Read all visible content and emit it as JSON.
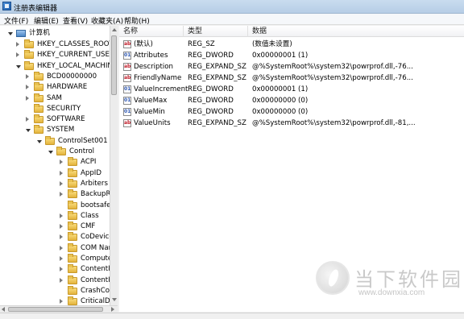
{
  "window": {
    "title": "注册表编辑器"
  },
  "menu": [
    "文件(F)",
    "编辑(E)",
    "查看(V)",
    "收藏夹(A)",
    "帮助(H)"
  ],
  "tree": {
    "root": "计算机",
    "items": [
      {
        "label": "HKEY_CLASSES_ROOT",
        "state": "collapsed"
      },
      {
        "label": "HKEY_CURRENT_USER",
        "state": "collapsed"
      },
      {
        "label": "HKEY_LOCAL_MACHINE",
        "state": "expanded"
      },
      {
        "label": "BCD00000000",
        "state": "collapsed"
      },
      {
        "label": "HARDWARE",
        "state": "collapsed"
      },
      {
        "label": "SAM",
        "state": "collapsed"
      },
      {
        "label": "SECURITY",
        "state": "none"
      },
      {
        "label": "SOFTWARE",
        "state": "collapsed"
      },
      {
        "label": "SYSTEM",
        "state": "expanded"
      },
      {
        "label": "ControlSet001",
        "state": "expanded"
      },
      {
        "label": "Control",
        "state": "expanded"
      },
      {
        "label": "ACPI",
        "state": "collapsed"
      },
      {
        "label": "AppID",
        "state": "collapsed"
      },
      {
        "label": "Arbiters",
        "state": "collapsed"
      },
      {
        "label": "BackupRe",
        "state": "collapsed"
      },
      {
        "label": "bootsafe",
        "state": "none"
      },
      {
        "label": "Class",
        "state": "collapsed"
      },
      {
        "label": "CMF",
        "state": "collapsed"
      },
      {
        "label": "CoDeviceI",
        "state": "collapsed"
      },
      {
        "label": "COM Nan",
        "state": "collapsed"
      },
      {
        "label": "Computer",
        "state": "collapsed"
      },
      {
        "label": "ContentIn",
        "state": "collapsed"
      },
      {
        "label": "ContentIn",
        "state": "collapsed"
      },
      {
        "label": "CrashCon",
        "state": "none"
      },
      {
        "label": "CriticalDe",
        "state": "collapsed"
      }
    ]
  },
  "values": {
    "columns": [
      "名称",
      "类型",
      "数据"
    ],
    "rows": [
      {
        "name": "(默认)",
        "type": "REG_SZ",
        "data": "(数值未设置)",
        "icon": "string"
      },
      {
        "name": "Attributes",
        "type": "REG_DWORD",
        "data": "0x00000001 (1)",
        "icon": "binary"
      },
      {
        "name": "Description",
        "type": "REG_EXPAND_SZ",
        "data": "@%SystemRoot%\\system32\\powrprof.dll,-76...",
        "icon": "string"
      },
      {
        "name": "FriendlyName",
        "type": "REG_EXPAND_SZ",
        "data": "@%SystemRoot%\\system32\\powrprof.dll,-76...",
        "icon": "string"
      },
      {
        "name": "ValueIncrement",
        "type": "REG_DWORD",
        "data": "0x00000001 (1)",
        "icon": "binary"
      },
      {
        "name": "ValueMax",
        "type": "REG_DWORD",
        "data": "0x00000000 (0)",
        "icon": "binary"
      },
      {
        "name": "ValueMin",
        "type": "REG_DWORD",
        "data": "0x00000000 (0)",
        "icon": "binary"
      },
      {
        "name": "ValueUnits",
        "type": "REG_EXPAND_SZ",
        "data": "@%SystemRoot%\\system32\\powrprof.dll,-81,...",
        "icon": "string"
      }
    ]
  },
  "watermark": {
    "title": "当下软件园",
    "url": "www.downxia.com"
  }
}
